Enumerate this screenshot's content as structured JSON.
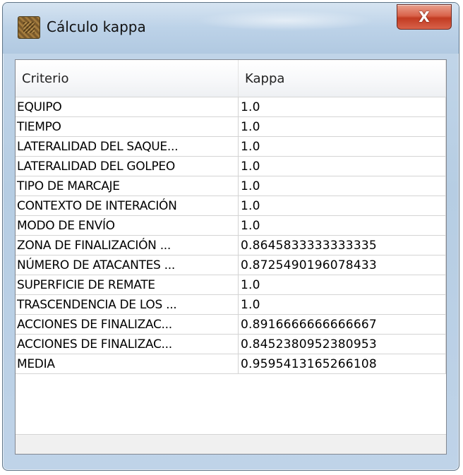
{
  "window": {
    "title": "Cálculo kappa",
    "icon": "app-icon",
    "close_label": "X"
  },
  "table": {
    "headers": [
      "Criterio",
      "Kappa"
    ],
    "rows": [
      {
        "criterio": "EQUIPO",
        "kappa": "1.0"
      },
      {
        "criterio": "TIEMPO",
        "kappa": "1.0"
      },
      {
        "criterio": "LATERALIDAD DEL SAQUE...",
        "kappa": "1.0"
      },
      {
        "criterio": "LATERALIDAD DEL GOLPEO",
        "kappa": "1.0"
      },
      {
        "criterio": "TIPO DE MARCAJE",
        "kappa": "1.0"
      },
      {
        "criterio": "CONTEXTO DE INTERACIÓN",
        "kappa": "1.0"
      },
      {
        "criterio": "MODO DE ENVÍO",
        "kappa": "1.0"
      },
      {
        "criterio": "ZONA DE FINALIZACIÓN ...",
        "kappa": "0.8645833333333335"
      },
      {
        "criterio": "NÚMERO DE ATACANTES ...",
        "kappa": "0.8725490196078433"
      },
      {
        "criterio": "SUPERFICIE DE REMATE",
        "kappa": "1.0"
      },
      {
        "criterio": "TRASCENDENCIA DE LOS ...",
        "kappa": "1.0"
      },
      {
        "criterio": "ACCIONES DE FINALIZAC...",
        "kappa": "0.8916666666666667"
      },
      {
        "criterio": "ACCIONES DE FINALIZAC...",
        "kappa": "0.8452380952380953"
      },
      {
        "criterio": "MEDIA",
        "kappa": "0.9595413165266108"
      }
    ]
  },
  "colors": {
    "close_button": "#c23b22",
    "title_bar": "#bcd2e8"
  }
}
